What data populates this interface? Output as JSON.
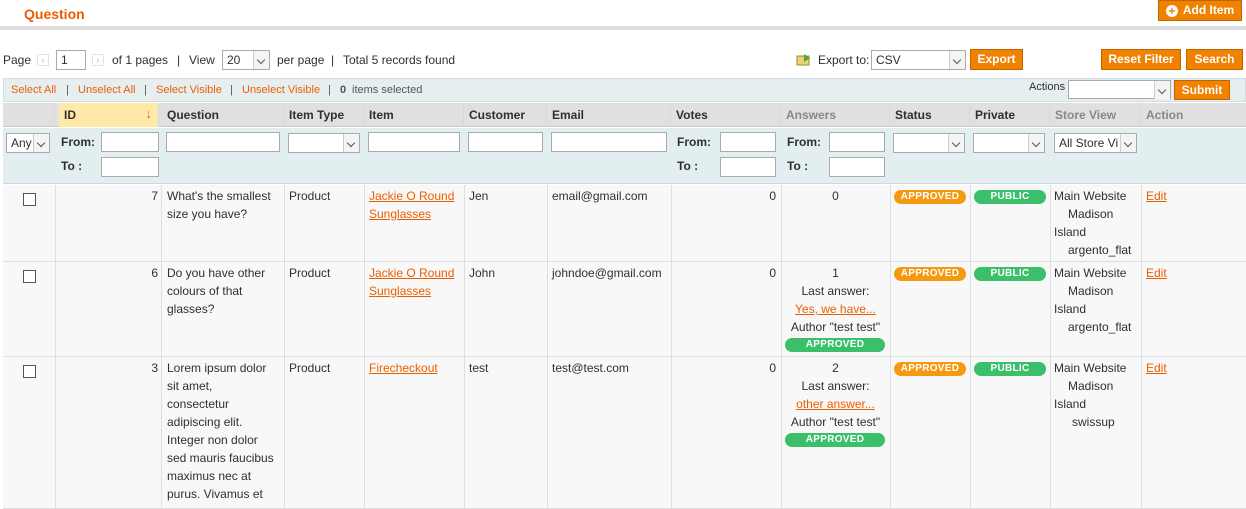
{
  "header": {
    "title": "Question",
    "add_item_label": "Add Item"
  },
  "pager": {
    "page_label": "Page",
    "page_value": "1",
    "of_pages": "of 1 pages",
    "sep1": "|",
    "view_label": "View",
    "view_value": "20",
    "per_page": "per page",
    "sep2": "|",
    "total": "Total 5 records found",
    "export_label": "Export to:",
    "export_value": "CSV",
    "export_button": "Export",
    "reset_filter": "Reset Filter",
    "search": "Search"
  },
  "massaction": {
    "select_all": "Select All",
    "unselect_all": "Unselect All",
    "select_visible": "Select Visible",
    "unselect_visible": "Unselect Visible",
    "sep": "|",
    "selected_count": "0",
    "selected_suffix": "items selected",
    "actions_label": "Actions",
    "submit": "Submit"
  },
  "columns": {
    "id": "ID",
    "question": "Question",
    "item_type": "Item Type",
    "item": "Item",
    "customer": "Customer",
    "email": "Email",
    "votes": "Votes",
    "answers": "Answers",
    "status": "Status",
    "private": "Private",
    "store_view": "Store View",
    "action": "Action"
  },
  "filters": {
    "any": "Any",
    "from": "From:",
    "to": "To :",
    "store_view_value": "All Store Vi"
  },
  "rows": [
    {
      "id": "7",
      "question_lines": [
        "What's the smallest",
        "size you have?"
      ],
      "item_type": "Product",
      "item_lines": [
        "Jackie O Round",
        "Sunglasses"
      ],
      "customer": "Jen",
      "email": "email@gmail.com",
      "votes": "0",
      "answers": {
        "count": "0"
      },
      "status": "APPROVED",
      "private": "PUBLIC",
      "store_lines": [
        "Main Website",
        "Madison",
        "Island",
        "argento_flat"
      ],
      "action": "Edit"
    },
    {
      "id": "6",
      "question_lines": [
        "Do you have other",
        "colours of that",
        "glasses?"
      ],
      "item_type": "Product",
      "item_lines": [
        "Jackie O Round",
        "Sunglasses"
      ],
      "customer": "John",
      "email": "johndoe@gmail.com",
      "votes": "0",
      "answers": {
        "count": "1",
        "last_label": "Last answer:",
        "last_link": "Yes, we have...",
        "author": "Author \"test test\"",
        "status": "APPROVED"
      },
      "status": "APPROVED",
      "private": "PUBLIC",
      "store_lines": [
        "Main Website",
        "Madison",
        "Island",
        "argento_flat"
      ],
      "action": "Edit"
    },
    {
      "id": "3",
      "question_lines": [
        "Lorem ipsum dolor",
        "sit amet,",
        "consectetur",
        "adipiscing elit.",
        "Integer non dolor",
        "sed mauris faucibus",
        "maximus nec at",
        "purus. Vivamus et"
      ],
      "item_type": "Product",
      "item_lines": [
        "Firecheckout"
      ],
      "customer": "test",
      "email": "test@test.com",
      "votes": "0",
      "answers": {
        "count": "2",
        "last_label": "Last answer:",
        "last_link": "other answer...",
        "author": "Author \"test test\"",
        "status": "APPROVED"
      },
      "status": "APPROVED",
      "private": "PUBLIC",
      "store_lines": [
        "Main Website",
        "Madison",
        "Island",
        "swissup"
      ],
      "action": "Edit"
    }
  ]
}
